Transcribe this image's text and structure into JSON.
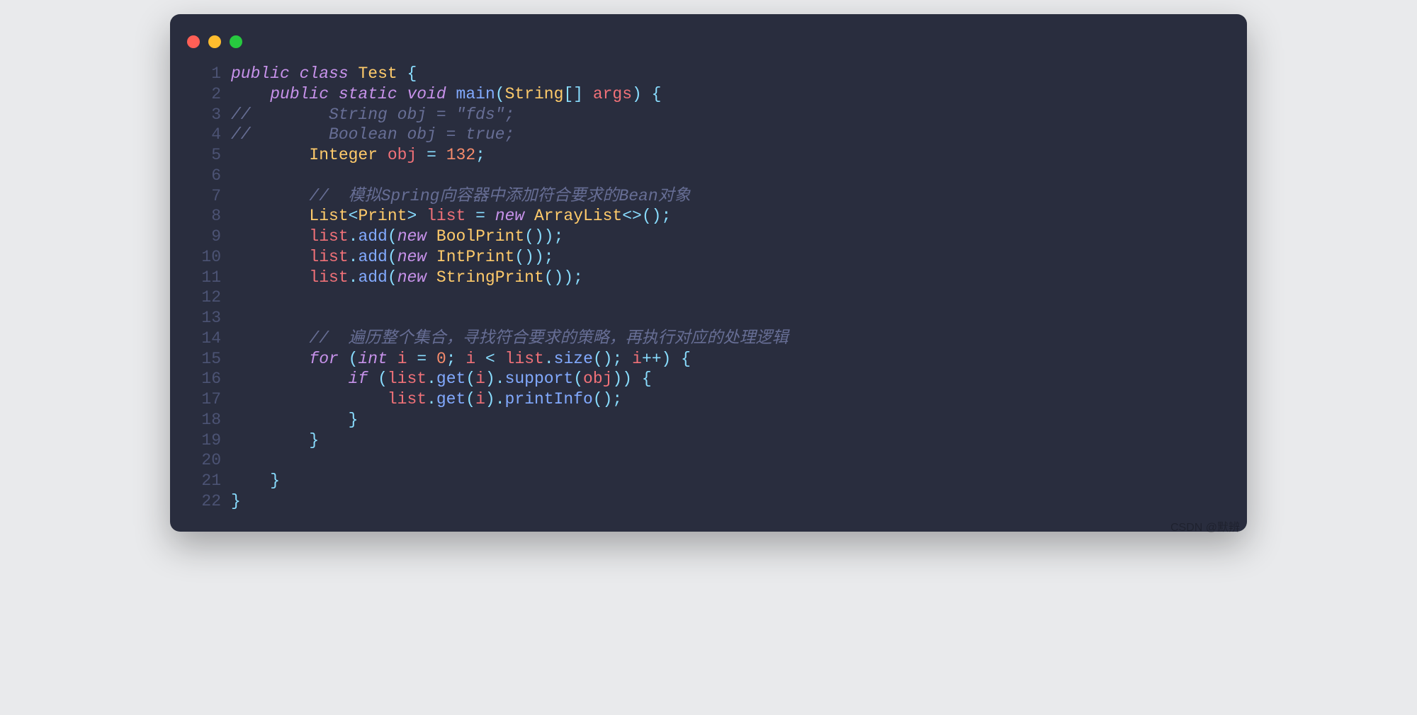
{
  "watermark": "CSDN @默辨",
  "code": {
    "lines": [
      {
        "n": "1",
        "tokens": [
          {
            "c": "kw",
            "t": "public"
          },
          {
            "c": "pn",
            "t": " "
          },
          {
            "c": "kw",
            "t": "class"
          },
          {
            "c": "pn",
            "t": " "
          },
          {
            "c": "type",
            "t": "Test"
          },
          {
            "c": "pn",
            "t": " "
          },
          {
            "c": "op",
            "t": "{"
          }
        ]
      },
      {
        "n": "2",
        "tokens": [
          {
            "c": "pn",
            "t": "    "
          },
          {
            "c": "kw",
            "t": "public"
          },
          {
            "c": "pn",
            "t": " "
          },
          {
            "c": "kw",
            "t": "static"
          },
          {
            "c": "pn",
            "t": " "
          },
          {
            "c": "kw",
            "t": "void"
          },
          {
            "c": "pn",
            "t": " "
          },
          {
            "c": "fn",
            "t": "main"
          },
          {
            "c": "op",
            "t": "("
          },
          {
            "c": "type",
            "t": "String"
          },
          {
            "c": "op",
            "t": "[]"
          },
          {
            "c": "pn",
            "t": " "
          },
          {
            "c": "var",
            "t": "args"
          },
          {
            "c": "op",
            "t": ")"
          },
          {
            "c": "pn",
            "t": " "
          },
          {
            "c": "op",
            "t": "{"
          }
        ]
      },
      {
        "n": "3",
        "tokens": [
          {
            "c": "cmt",
            "t": "//        String obj = \"fds\";"
          }
        ]
      },
      {
        "n": "4",
        "tokens": [
          {
            "c": "cmt",
            "t": "//        Boolean obj = true;"
          }
        ]
      },
      {
        "n": "5",
        "tokens": [
          {
            "c": "pn",
            "t": "        "
          },
          {
            "c": "type",
            "t": "Integer"
          },
          {
            "c": "pn",
            "t": " "
          },
          {
            "c": "var",
            "t": "obj"
          },
          {
            "c": "pn",
            "t": " "
          },
          {
            "c": "op",
            "t": "="
          },
          {
            "c": "pn",
            "t": " "
          },
          {
            "c": "num",
            "t": "132"
          },
          {
            "c": "op",
            "t": ";"
          }
        ]
      },
      {
        "n": "6",
        "tokens": [
          {
            "c": "pn",
            "t": ""
          }
        ]
      },
      {
        "n": "7",
        "tokens": [
          {
            "c": "pn",
            "t": "        "
          },
          {
            "c": "cmt",
            "t": "//  模拟Spring向容器中添加符合要求的Bean对象"
          }
        ]
      },
      {
        "n": "8",
        "tokens": [
          {
            "c": "pn",
            "t": "        "
          },
          {
            "c": "type",
            "t": "List"
          },
          {
            "c": "op",
            "t": "<"
          },
          {
            "c": "type",
            "t": "Print"
          },
          {
            "c": "op",
            "t": ">"
          },
          {
            "c": "pn",
            "t": " "
          },
          {
            "c": "var",
            "t": "list"
          },
          {
            "c": "pn",
            "t": " "
          },
          {
            "c": "op",
            "t": "="
          },
          {
            "c": "pn",
            "t": " "
          },
          {
            "c": "kw",
            "t": "new"
          },
          {
            "c": "pn",
            "t": " "
          },
          {
            "c": "type",
            "t": "ArrayList"
          },
          {
            "c": "op",
            "t": "<>"
          },
          {
            "c": "op",
            "t": "()"
          },
          {
            "c": "op",
            "t": ";"
          }
        ]
      },
      {
        "n": "9",
        "tokens": [
          {
            "c": "pn",
            "t": "        "
          },
          {
            "c": "var",
            "t": "list"
          },
          {
            "c": "op",
            "t": "."
          },
          {
            "c": "fn",
            "t": "add"
          },
          {
            "c": "op",
            "t": "("
          },
          {
            "c": "kw",
            "t": "new"
          },
          {
            "c": "pn",
            "t": " "
          },
          {
            "c": "type",
            "t": "BoolPrint"
          },
          {
            "c": "op",
            "t": "()"
          },
          {
            "c": "op",
            "t": ")"
          },
          {
            "c": "op",
            "t": ";"
          }
        ]
      },
      {
        "n": "10",
        "tokens": [
          {
            "c": "pn",
            "t": "        "
          },
          {
            "c": "var",
            "t": "list"
          },
          {
            "c": "op",
            "t": "."
          },
          {
            "c": "fn",
            "t": "add"
          },
          {
            "c": "op",
            "t": "("
          },
          {
            "c": "kw",
            "t": "new"
          },
          {
            "c": "pn",
            "t": " "
          },
          {
            "c": "type",
            "t": "IntPrint"
          },
          {
            "c": "op",
            "t": "()"
          },
          {
            "c": "op",
            "t": ")"
          },
          {
            "c": "op",
            "t": ";"
          }
        ]
      },
      {
        "n": "11",
        "tokens": [
          {
            "c": "pn",
            "t": "        "
          },
          {
            "c": "var",
            "t": "list"
          },
          {
            "c": "op",
            "t": "."
          },
          {
            "c": "fn",
            "t": "add"
          },
          {
            "c": "op",
            "t": "("
          },
          {
            "c": "kw",
            "t": "new"
          },
          {
            "c": "pn",
            "t": " "
          },
          {
            "c": "type",
            "t": "StringPrint"
          },
          {
            "c": "op",
            "t": "()"
          },
          {
            "c": "op",
            "t": ")"
          },
          {
            "c": "op",
            "t": ";"
          }
        ]
      },
      {
        "n": "12",
        "tokens": [
          {
            "c": "pn",
            "t": ""
          }
        ]
      },
      {
        "n": "13",
        "tokens": [
          {
            "c": "pn",
            "t": ""
          }
        ]
      },
      {
        "n": "14",
        "tokens": [
          {
            "c": "pn",
            "t": "        "
          },
          {
            "c": "cmt",
            "t": "//  遍历整个集合，寻找符合要求的策略，再执行对应的处理逻辑"
          }
        ]
      },
      {
        "n": "15",
        "tokens": [
          {
            "c": "pn",
            "t": "        "
          },
          {
            "c": "kw",
            "t": "for"
          },
          {
            "c": "pn",
            "t": " "
          },
          {
            "c": "op",
            "t": "("
          },
          {
            "c": "kw",
            "t": "int"
          },
          {
            "c": "pn",
            "t": " "
          },
          {
            "c": "var",
            "t": "i"
          },
          {
            "c": "pn",
            "t": " "
          },
          {
            "c": "op",
            "t": "="
          },
          {
            "c": "pn",
            "t": " "
          },
          {
            "c": "num",
            "t": "0"
          },
          {
            "c": "op",
            "t": ";"
          },
          {
            "c": "pn",
            "t": " "
          },
          {
            "c": "var",
            "t": "i"
          },
          {
            "c": "pn",
            "t": " "
          },
          {
            "c": "op",
            "t": "<"
          },
          {
            "c": "pn",
            "t": " "
          },
          {
            "c": "var",
            "t": "list"
          },
          {
            "c": "op",
            "t": "."
          },
          {
            "c": "fn",
            "t": "size"
          },
          {
            "c": "op",
            "t": "()"
          },
          {
            "c": "op",
            "t": ";"
          },
          {
            "c": "pn",
            "t": " "
          },
          {
            "c": "var",
            "t": "i"
          },
          {
            "c": "op",
            "t": "++"
          },
          {
            "c": "op",
            "t": ")"
          },
          {
            "c": "pn",
            "t": " "
          },
          {
            "c": "op",
            "t": "{"
          }
        ]
      },
      {
        "n": "16",
        "tokens": [
          {
            "c": "pn",
            "t": "            "
          },
          {
            "c": "kw",
            "t": "if"
          },
          {
            "c": "pn",
            "t": " "
          },
          {
            "c": "op",
            "t": "("
          },
          {
            "c": "var",
            "t": "list"
          },
          {
            "c": "op",
            "t": "."
          },
          {
            "c": "fn",
            "t": "get"
          },
          {
            "c": "op",
            "t": "("
          },
          {
            "c": "var",
            "t": "i"
          },
          {
            "c": "op",
            "t": ")"
          },
          {
            "c": "op",
            "t": "."
          },
          {
            "c": "fn",
            "t": "support"
          },
          {
            "c": "op",
            "t": "("
          },
          {
            "c": "var",
            "t": "obj"
          },
          {
            "c": "op",
            "t": ")"
          },
          {
            "c": "op",
            "t": ")"
          },
          {
            "c": "pn",
            "t": " "
          },
          {
            "c": "op",
            "t": "{"
          }
        ]
      },
      {
        "n": "17",
        "tokens": [
          {
            "c": "pn",
            "t": "                "
          },
          {
            "c": "var",
            "t": "list"
          },
          {
            "c": "op",
            "t": "."
          },
          {
            "c": "fn",
            "t": "get"
          },
          {
            "c": "op",
            "t": "("
          },
          {
            "c": "var",
            "t": "i"
          },
          {
            "c": "op",
            "t": ")"
          },
          {
            "c": "op",
            "t": "."
          },
          {
            "c": "fn",
            "t": "printInfo"
          },
          {
            "c": "op",
            "t": "()"
          },
          {
            "c": "op",
            "t": ";"
          }
        ]
      },
      {
        "n": "18",
        "tokens": [
          {
            "c": "pn",
            "t": "            "
          },
          {
            "c": "op",
            "t": "}"
          }
        ]
      },
      {
        "n": "19",
        "tokens": [
          {
            "c": "pn",
            "t": "        "
          },
          {
            "c": "op",
            "t": "}"
          }
        ]
      },
      {
        "n": "20",
        "tokens": [
          {
            "c": "pn",
            "t": ""
          }
        ]
      },
      {
        "n": "21",
        "tokens": [
          {
            "c": "pn",
            "t": "    "
          },
          {
            "c": "op",
            "t": "}"
          }
        ]
      },
      {
        "n": "22",
        "tokens": [
          {
            "c": "op",
            "t": "}"
          }
        ]
      }
    ]
  }
}
